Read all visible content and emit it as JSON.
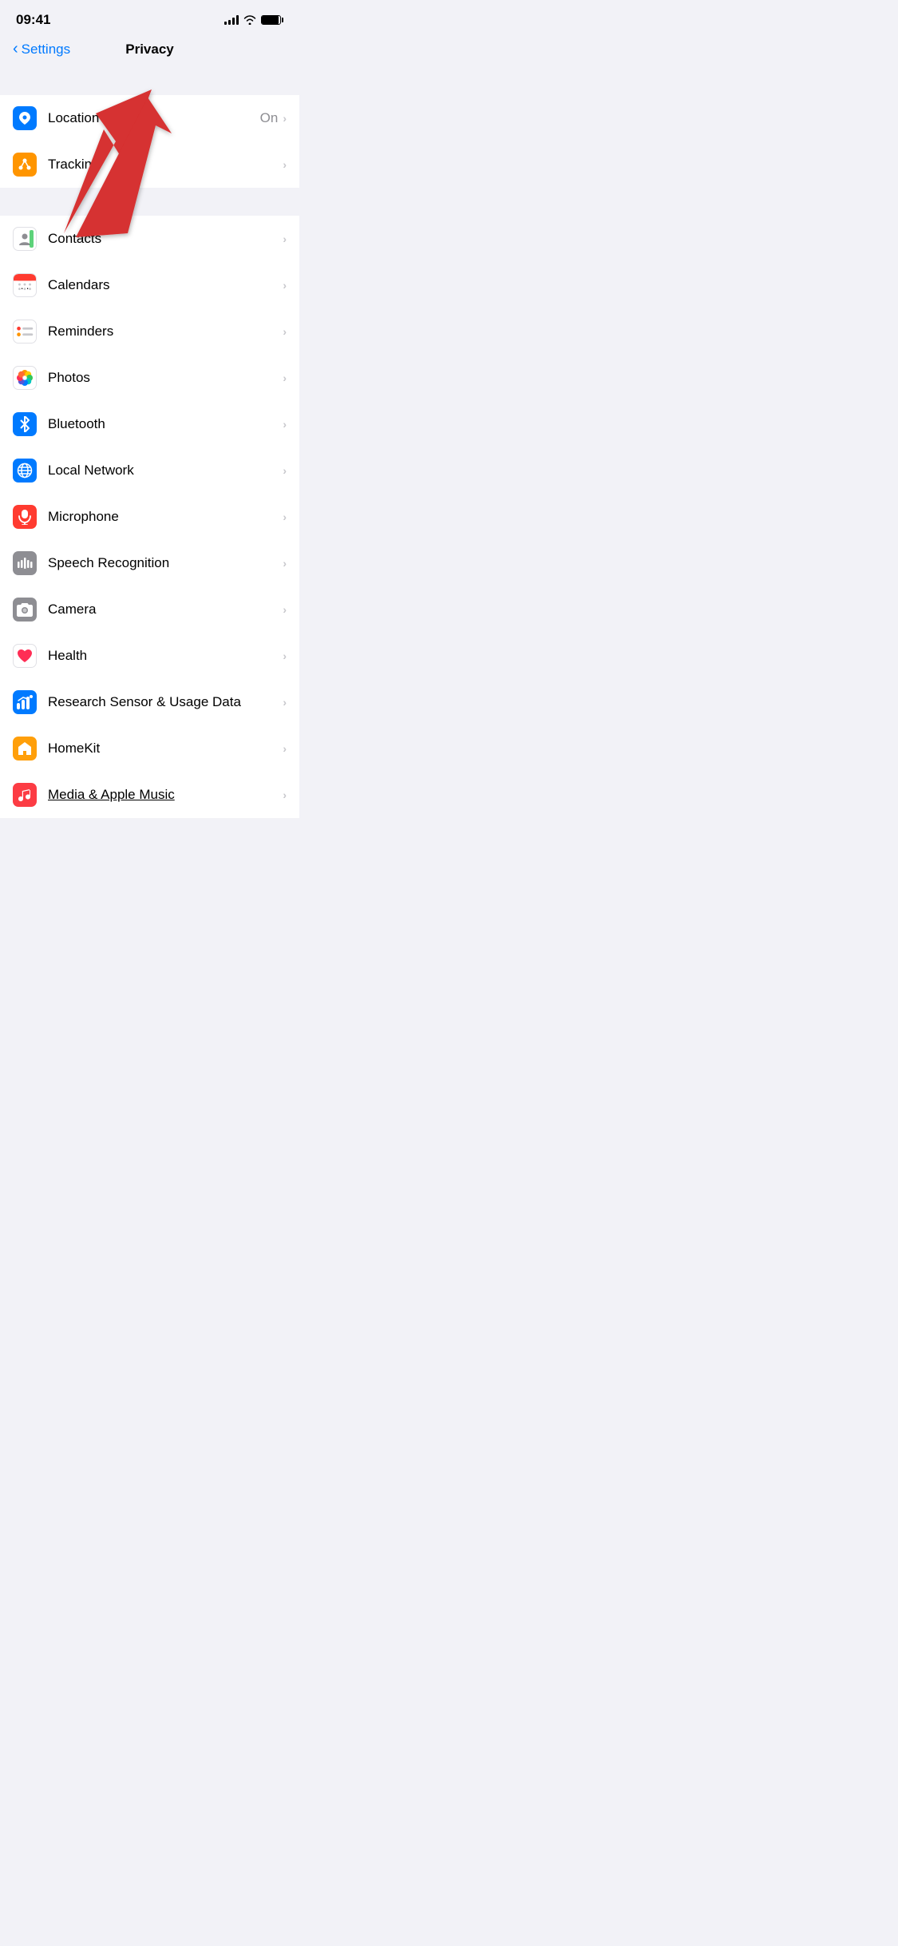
{
  "statusBar": {
    "time": "09:41"
  },
  "navBar": {
    "back_label": "Settings",
    "title": "Privacy"
  },
  "sections": [
    {
      "id": "top",
      "items": [
        {
          "id": "location-services",
          "label": "Location Services",
          "value": "On",
          "icon": "arrow",
          "icon_bg": "blue",
          "icon_char": "➤"
        },
        {
          "id": "tracking",
          "label": "Tracking",
          "value": "",
          "icon": "tracking",
          "icon_bg": "orange",
          "icon_char": "⬢"
        }
      ]
    },
    {
      "id": "bottom",
      "items": [
        {
          "id": "contacts",
          "label": "Contacts",
          "value": "",
          "icon": "contacts",
          "icon_bg": "gray",
          "icon_char": "👤"
        },
        {
          "id": "calendars",
          "label": "Calendars",
          "value": "",
          "icon": "calendars",
          "icon_bg": "calendar"
        },
        {
          "id": "reminders",
          "label": "Reminders",
          "value": "",
          "icon": "reminders",
          "icon_bg": "reminders"
        },
        {
          "id": "photos",
          "label": "Photos",
          "value": "",
          "icon": "photos",
          "icon_bg": "photos"
        },
        {
          "id": "bluetooth",
          "label": "Bluetooth",
          "value": "",
          "icon": "bluetooth",
          "icon_bg": "blue-dark",
          "icon_char": "B"
        },
        {
          "id": "local-network",
          "label": "Local Network",
          "value": "",
          "icon": "globe",
          "icon_bg": "globe-blue",
          "icon_char": "🌐"
        },
        {
          "id": "microphone",
          "label": "Microphone",
          "value": "",
          "icon": "microphone",
          "icon_bg": "red",
          "icon_char": "🎙"
        },
        {
          "id": "speech-recognition",
          "label": "Speech Recognition",
          "value": "",
          "icon": "speech",
          "icon_bg": "gray-dark"
        },
        {
          "id": "camera",
          "label": "Camera",
          "value": "",
          "icon": "camera",
          "icon_bg": "gray-camera"
        },
        {
          "id": "health",
          "label": "Health",
          "value": "",
          "icon": "health",
          "icon_bg": "health-white"
        },
        {
          "id": "research",
          "label": "Research Sensor & Usage Data",
          "value": "",
          "icon": "research",
          "icon_bg": "blue-research"
        },
        {
          "id": "homekit",
          "label": "HomeKit",
          "value": "",
          "icon": "home",
          "icon_bg": "orange-home",
          "icon_char": "🏠"
        },
        {
          "id": "media",
          "label": "Media & Apple Music",
          "value": "",
          "icon": "music",
          "icon_bg": "red-music",
          "icon_char": "♫"
        }
      ]
    }
  ],
  "arrow": {
    "visible": true
  }
}
